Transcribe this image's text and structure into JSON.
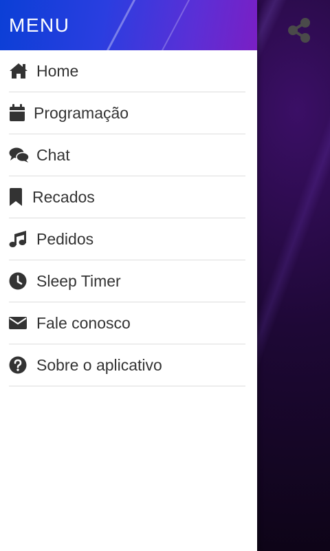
{
  "menu": {
    "title": "MENU",
    "items": [
      {
        "label": "Home",
        "icon": "home-icon"
      },
      {
        "label": "Programação",
        "icon": "calendar-icon"
      },
      {
        "label": "Chat",
        "icon": "chat-icon"
      },
      {
        "label": "Recados",
        "icon": "bookmark-icon"
      },
      {
        "label": "Pedidos",
        "icon": "music-note-icon"
      },
      {
        "label": "Sleep Timer",
        "icon": "clock-icon"
      },
      {
        "label": "Fale conosco",
        "icon": "envelope-icon"
      },
      {
        "label": "Sobre o aplicativo",
        "icon": "question-circle-icon"
      }
    ]
  },
  "share": {
    "icon": "share-icon"
  },
  "colors": {
    "icon": "#333333",
    "text": "#333333",
    "divider": "#dcdcdc",
    "header_start": "#0b3fd6",
    "header_end": "#7a1fc4",
    "backdrop": "#12081c"
  }
}
